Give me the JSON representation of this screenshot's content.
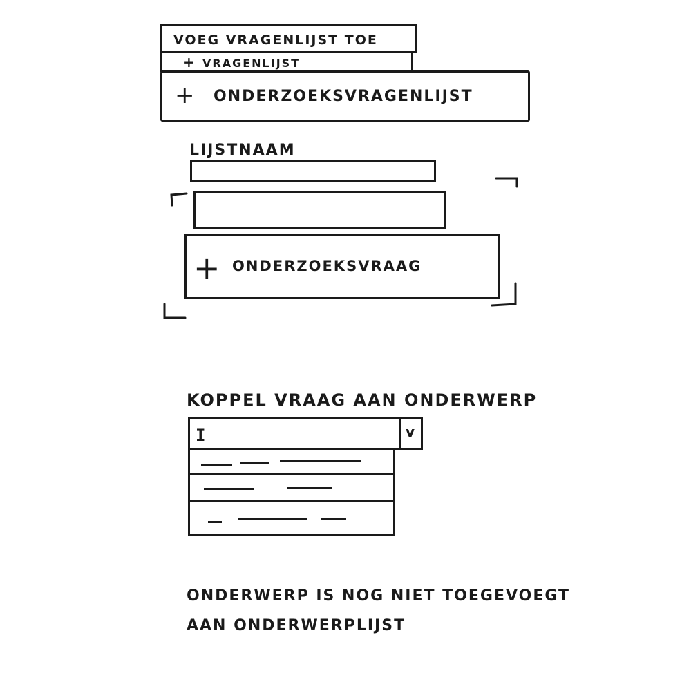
{
  "add_list": {
    "title": "VOEG VRAGENLIJST TOE",
    "menu_items": [
      {
        "icon": "plus-icon",
        "label": "VRAGENLIJST"
      },
      {
        "icon": "plus-icon",
        "label": "ONDERZOEKSVRAGENLIJST"
      }
    ]
  },
  "list_form": {
    "name_label": "LIJSTNAAM",
    "name_value": "",
    "question_value": "",
    "add_question_icon": "plus-icon",
    "add_question_label": "ONDERZOEKSVRAAG"
  },
  "link_section": {
    "title": "KOPPEL VRAAG AAN ONDERWERP",
    "dropdown_icon": "chevron-down-icon",
    "input_value": "",
    "options": [
      "",
      "",
      ""
    ]
  },
  "warning": {
    "line1": "ONDERWERP IS NOG NIET TOEGEVOEGT",
    "line2": "AAN ONDERWERPLIJST"
  }
}
